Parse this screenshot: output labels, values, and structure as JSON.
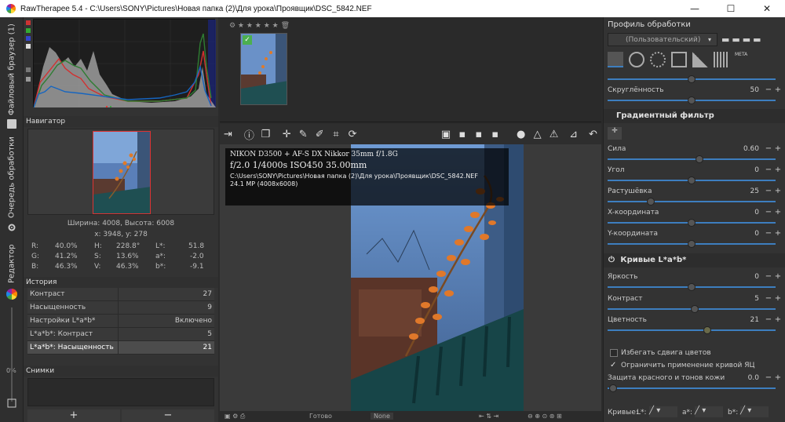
{
  "window": {
    "title": "RawTherapee 5.4 - C:\\Users\\SONY\\Pictures\\Новая папка (2)\\Для урока\\Проявщик\\DSC_5842.NEF",
    "minimize": "—",
    "maximize": "☐",
    "close": "✕"
  },
  "left_tabs": {
    "file_browser": "Файловый браузер (1)",
    "queue": "Очередь обработки",
    "editor": "Редактор",
    "zoom_pct": "0%"
  },
  "navigator": {
    "header": "Навигатор",
    "size": "Ширина: 4008, Высота: 6008",
    "coords": "x: 3948, y: 278",
    "readouts": [
      {
        "label": "R:",
        "value": "40.0%",
        "label2": "H:",
        "value2": "228.8°",
        "label3": "L*:",
        "value3": "51.8"
      },
      {
        "label": "G:",
        "value": "41.2%",
        "label2": "S:",
        "value2": "13.6%",
        "label3": "a*:",
        "value3": "-2.0"
      },
      {
        "label": "B:",
        "value": "46.3%",
        "label2": "V:",
        "value2": "46.3%",
        "label3": "b*:",
        "value3": "-9.1"
      }
    ]
  },
  "history": {
    "header": "История",
    "rows": [
      {
        "name": "Контраст",
        "value": "27"
      },
      {
        "name": "Насыщенность",
        "value": "9"
      },
      {
        "name": "Настройки L*a*b*",
        "value": "Включено"
      },
      {
        "name": "L*a*b*: Контраст",
        "value": "5"
      },
      {
        "name": "L*a*b*: Насыщенность",
        "value": "21"
      }
    ]
  },
  "snapshots": {
    "header": "Снимки",
    "add": "+",
    "remove": "−"
  },
  "exif": {
    "line1": "NIKON D3500 + AF-S DX Nikkor 35mm f/1.8G",
    "line2": "f/2.0  1/4000s  ISO450  35.00mm",
    "line3": "C:\\Users\\SONY\\Pictures\\Новая папка (2)\\Для урока\\Проявщик\\DSC_5842.NEF",
    "line4": "24.1 MP (4008x6008)"
  },
  "statusbar": {
    "ready": "Готово",
    "none": "None"
  },
  "profile": {
    "header": "Профиль обработки",
    "selected": "(Пользовательский)"
  },
  "right_panel": {
    "roundness_label": "Скруглённость",
    "roundness_value": "50",
    "gradient_header": "Градиентный фильтр",
    "gradient": [
      {
        "label": "Сила",
        "value": "0.60",
        "pos": 0.55
      },
      {
        "label": "Угол",
        "value": "0",
        "pos": 0.5
      },
      {
        "label": "Растушёвка",
        "value": "25",
        "pos": 0.25
      },
      {
        "label": "X-координата",
        "value": "0",
        "pos": 0.5
      },
      {
        "label": "Y-координата",
        "value": "0",
        "pos": 0.5
      }
    ],
    "lab_header": "Кривые L*a*b*",
    "lab": [
      {
        "label": "Яркость",
        "value": "0",
        "pos": 0.5
      },
      {
        "label": "Контраст",
        "value": "5",
        "pos": 0.52
      },
      {
        "label": "Цветность",
        "value": "21",
        "pos": 0.6
      }
    ],
    "avoid_shift": "Избегать сдвига цветов",
    "limit_curve": "Ограничить применение кривой ЯЦ",
    "protect_label": "Защита красного и тонов кожи",
    "protect_value": "0.0",
    "curves_label": "Кривые:",
    "curves_l": "L*:",
    "curves_a": "a*:",
    "curves_b": "b*:"
  }
}
